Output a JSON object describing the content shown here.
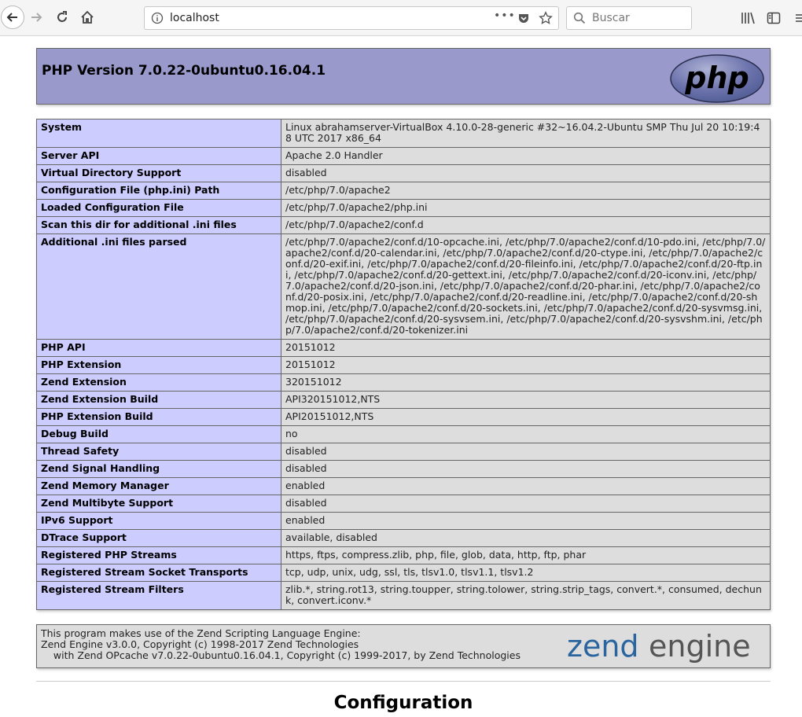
{
  "browser": {
    "url": "localhost",
    "search_placeholder": "Buscar",
    "url_dots": "•••"
  },
  "header": {
    "title": "PHP Version 7.0.22-0ubuntu0.16.04.1",
    "logo_text": "php"
  },
  "rows": [
    {
      "key": "System",
      "value": "Linux abrahamserver-VirtualBox 4.10.0-28-generic #32~16.04.2-Ubuntu SMP Thu Jul 20 10:19:48 UTC 2017 x86_64"
    },
    {
      "key": "Server API",
      "value": "Apache 2.0 Handler"
    },
    {
      "key": "Virtual Directory Support",
      "value": "disabled"
    },
    {
      "key": "Configuration File (php.ini) Path",
      "value": "/etc/php/7.0/apache2"
    },
    {
      "key": "Loaded Configuration File",
      "value": "/etc/php/7.0/apache2/php.ini"
    },
    {
      "key": "Scan this dir for additional .ini files",
      "value": "/etc/php/7.0/apache2/conf.d"
    },
    {
      "key": "Additional .ini files parsed",
      "value": "/etc/php/7.0/apache2/conf.d/10-opcache.ini, /etc/php/7.0/apache2/conf.d/10-pdo.ini, /etc/php/7.0/apache2/conf.d/20-calendar.ini, /etc/php/7.0/apache2/conf.d/20-ctype.ini, /etc/php/7.0/apache2/conf.d/20-exif.ini, /etc/php/7.0/apache2/conf.d/20-fileinfo.ini, /etc/php/7.0/apache2/conf.d/20-ftp.ini, /etc/php/7.0/apache2/conf.d/20-gettext.ini, /etc/php/7.0/apache2/conf.d/20-iconv.ini, /etc/php/7.0/apache2/conf.d/20-json.ini, /etc/php/7.0/apache2/conf.d/20-phar.ini, /etc/php/7.0/apache2/conf.d/20-posix.ini, /etc/php/7.0/apache2/conf.d/20-readline.ini, /etc/php/7.0/apache2/conf.d/20-shmop.ini, /etc/php/7.0/apache2/conf.d/20-sockets.ini, /etc/php/7.0/apache2/conf.d/20-sysvmsg.ini, /etc/php/7.0/apache2/conf.d/20-sysvsem.ini, /etc/php/7.0/apache2/conf.d/20-sysvshm.ini, /etc/php/7.0/apache2/conf.d/20-tokenizer.ini"
    },
    {
      "key": "PHP API",
      "value": "20151012"
    },
    {
      "key": "PHP Extension",
      "value": "20151012"
    },
    {
      "key": "Zend Extension",
      "value": "320151012"
    },
    {
      "key": "Zend Extension Build",
      "value": "API320151012,NTS"
    },
    {
      "key": "PHP Extension Build",
      "value": "API20151012,NTS"
    },
    {
      "key": "Debug Build",
      "value": "no"
    },
    {
      "key": "Thread Safety",
      "value": "disabled"
    },
    {
      "key": "Zend Signal Handling",
      "value": "disabled"
    },
    {
      "key": "Zend Memory Manager",
      "value": "enabled"
    },
    {
      "key": "Zend Multibyte Support",
      "value": "disabled"
    },
    {
      "key": "IPv6 Support",
      "value": "enabled"
    },
    {
      "key": "DTrace Support",
      "value": "available, disabled"
    },
    {
      "key": "Registered PHP Streams",
      "value": "https, ftps, compress.zlib, php, file, glob, data, http, ftp, phar"
    },
    {
      "key": "Registered Stream Socket Transports",
      "value": "tcp, udp, unix, udg, ssl, tls, tlsv1.0, tlsv1.1, tlsv1.2"
    },
    {
      "key": "Registered Stream Filters",
      "value": "zlib.*, string.rot13, string.toupper, string.tolower, string.strip_tags, convert.*, consumed, dechunk, convert.iconv.*"
    }
  ],
  "zend": {
    "line1": "This program makes use of the Zend Scripting Language Engine:",
    "line2": "Zend Engine v3.0.0, Copyright (c) 1998-2017 Zend Technologies",
    "line3": "    with Zend OPcache v7.0.22-0ubuntu0.16.04.1, Copyright (c) 1999-2017, by Zend Technologies",
    "logo_text_1": "zend",
    "logo_text_2": "engine"
  },
  "section_title": "Configuration",
  "colors": {
    "header_bg": "#9999cc",
    "key_bg": "#ccccff",
    "value_bg": "#dddddd"
  }
}
